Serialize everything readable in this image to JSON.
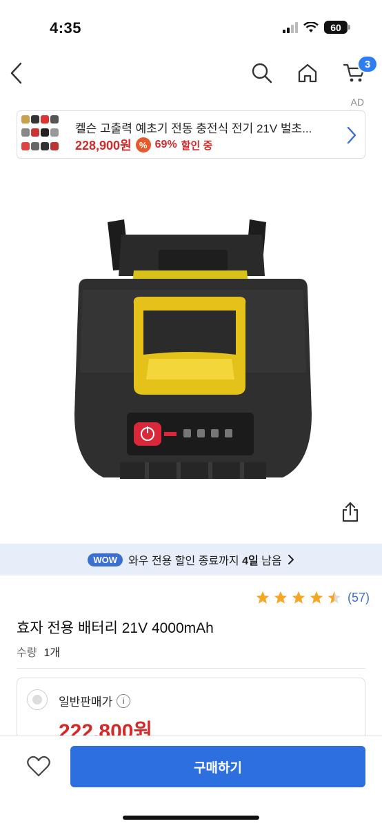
{
  "status_bar": {
    "time": "4:35",
    "battery": "60"
  },
  "nav": {
    "cart_count": "3"
  },
  "ad": {
    "label": "AD",
    "title": "켈슨 고출력 예초기 전동 충전식 전기 21V 벌초...",
    "price": "228,900원",
    "percent_symbol": "%",
    "discount": "69%",
    "discount_suffix": "할인 중"
  },
  "wow_banner": {
    "badge": "WOW",
    "text_prefix": "와우 전용 할인 종료까지",
    "days": "4일",
    "text_suffix": "남음"
  },
  "product": {
    "rating_value": 4.5,
    "review_count": "(57)",
    "title": "효자 전용 배터리 21V 4000mAh",
    "qty_label": "수량",
    "qty_value": "1개"
  },
  "price_option": {
    "label": "일반판매가",
    "info_symbol": "i",
    "price": "222,800원"
  },
  "bottom": {
    "buy_label": "구매하기"
  },
  "colors": {
    "accent": "#2e6fe0",
    "price_red": "#d32b2b",
    "star": "#f5a623",
    "wow_bg": "#e8eef9"
  }
}
